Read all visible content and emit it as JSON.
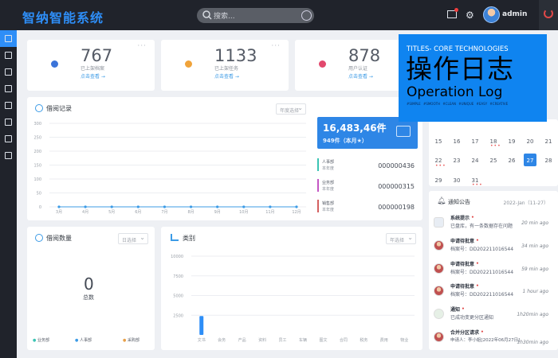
{
  "app": {
    "title": "智纳智能系统",
    "user": "admin",
    "search_placeholder": "搜索..."
  },
  "colors": {
    "accent": "#2e8ef7",
    "sidebar": "#20232b",
    "overlay": "#0f84f0"
  },
  "stats": [
    {
      "value": "767",
      "label": "已上架档案",
      "link": "点击查看 →",
      "dot": "#3b74d9"
    },
    {
      "value": "1133",
      "label": "已上架任务",
      "link": "点击查看 →",
      "dot": "#f0a33a"
    },
    {
      "value": "878",
      "label": "用户认证",
      "link": "点击查看 →",
      "dot": "#e2486d"
    }
  ],
  "overlay": {
    "line1": "TITLES- CORE TECHNOLOGIES",
    "line2": "操作日志",
    "line3": "Operation Log",
    "tags": "#SIMPLE #SMOOTH #CLEAN #UNIQUE #EASY #CREATIVE"
  },
  "borrow": {
    "title": "借阅记录",
    "select": "年度选择",
    "big_value": "16,483,46件",
    "big_sub": "949件（本月★）",
    "legend": [
      {
        "name": "人事部",
        "sub": "本年度",
        "value": "000000436",
        "color": "#3cc4b4"
      },
      {
        "name": "业务部",
        "sub": "本年度",
        "value": "000000315",
        "color": "#c457c4"
      },
      {
        "name": "销售部",
        "sub": "本年度",
        "value": "000000198",
        "color": "#d46060"
      }
    ]
  },
  "chart_data": [
    {
      "type": "line",
      "title": "借阅记录",
      "categories": [
        "3月",
        "4月",
        "5月",
        "6月",
        "7月",
        "8月",
        "9月",
        "10月",
        "11月",
        "12月"
      ],
      "yticks": [
        0,
        50,
        100,
        150,
        200,
        250,
        300
      ],
      "ylim": [
        0,
        300
      ],
      "series": [
        {
          "values": [
            0,
            0,
            0,
            0,
            0,
            0,
            0,
            0,
            0,
            0
          ]
        }
      ]
    },
    {
      "type": "bar",
      "title": "类别",
      "categories": [
        "文书",
        "会务",
        "产品",
        "资料",
        "员工",
        "车辆",
        "图文",
        "合同",
        "税务",
        "费用",
        "物业"
      ],
      "yticks": [
        2500,
        5000,
        7500,
        10000
      ],
      "ylim": [
        0,
        10000
      ],
      "values": [
        2400,
        0,
        0,
        0,
        0,
        0,
        0,
        0,
        0,
        0,
        0
      ]
    }
  ],
  "borrow_count": {
    "title": "借阅数量",
    "select": "日选择",
    "value": "0",
    "label": "总数",
    "legend": [
      "业务部",
      "人事部",
      "采购部"
    ]
  },
  "category": {
    "title": "类别",
    "select": "年选择"
  },
  "calendar": {
    "rows": [
      [
        "15",
        "16",
        "17",
        "18",
        "19",
        "20",
        "21"
      ],
      [
        "22",
        "23",
        "24",
        "25",
        "26",
        "27",
        "28"
      ],
      [
        "29",
        "30",
        "31"
      ]
    ],
    "today": "27"
  },
  "announcements": {
    "title": "通知公告",
    "date": "2022-Jan（11-27）",
    "items": [
      {
        "head": "系统提示",
        "sub": "已盘库，有一条数据存在问题",
        "time": "20 min ago"
      },
      {
        "head": "申请待批意",
        "sub": "档案号：DD202211016544",
        "time": "34 min ago"
      },
      {
        "head": "申请待批意",
        "sub": "档案号：DD202211016544",
        "time": "59 min ago"
      },
      {
        "head": "申请待批意",
        "sub": "档案号：DD202211016544",
        "time": "1 hour ago"
      },
      {
        "head": "通知",
        "sub": "已成功变更分区通知",
        "time": "1h20min ago"
      },
      {
        "head": "合并分区请求",
        "sub": "申请人：李小姐[2022年06月27日]",
        "time": "1h30min ago"
      }
    ]
  },
  "icons": [
    "search-icon",
    "mail-icon",
    "gear-icon",
    "power-icon",
    "menu-icon"
  ]
}
